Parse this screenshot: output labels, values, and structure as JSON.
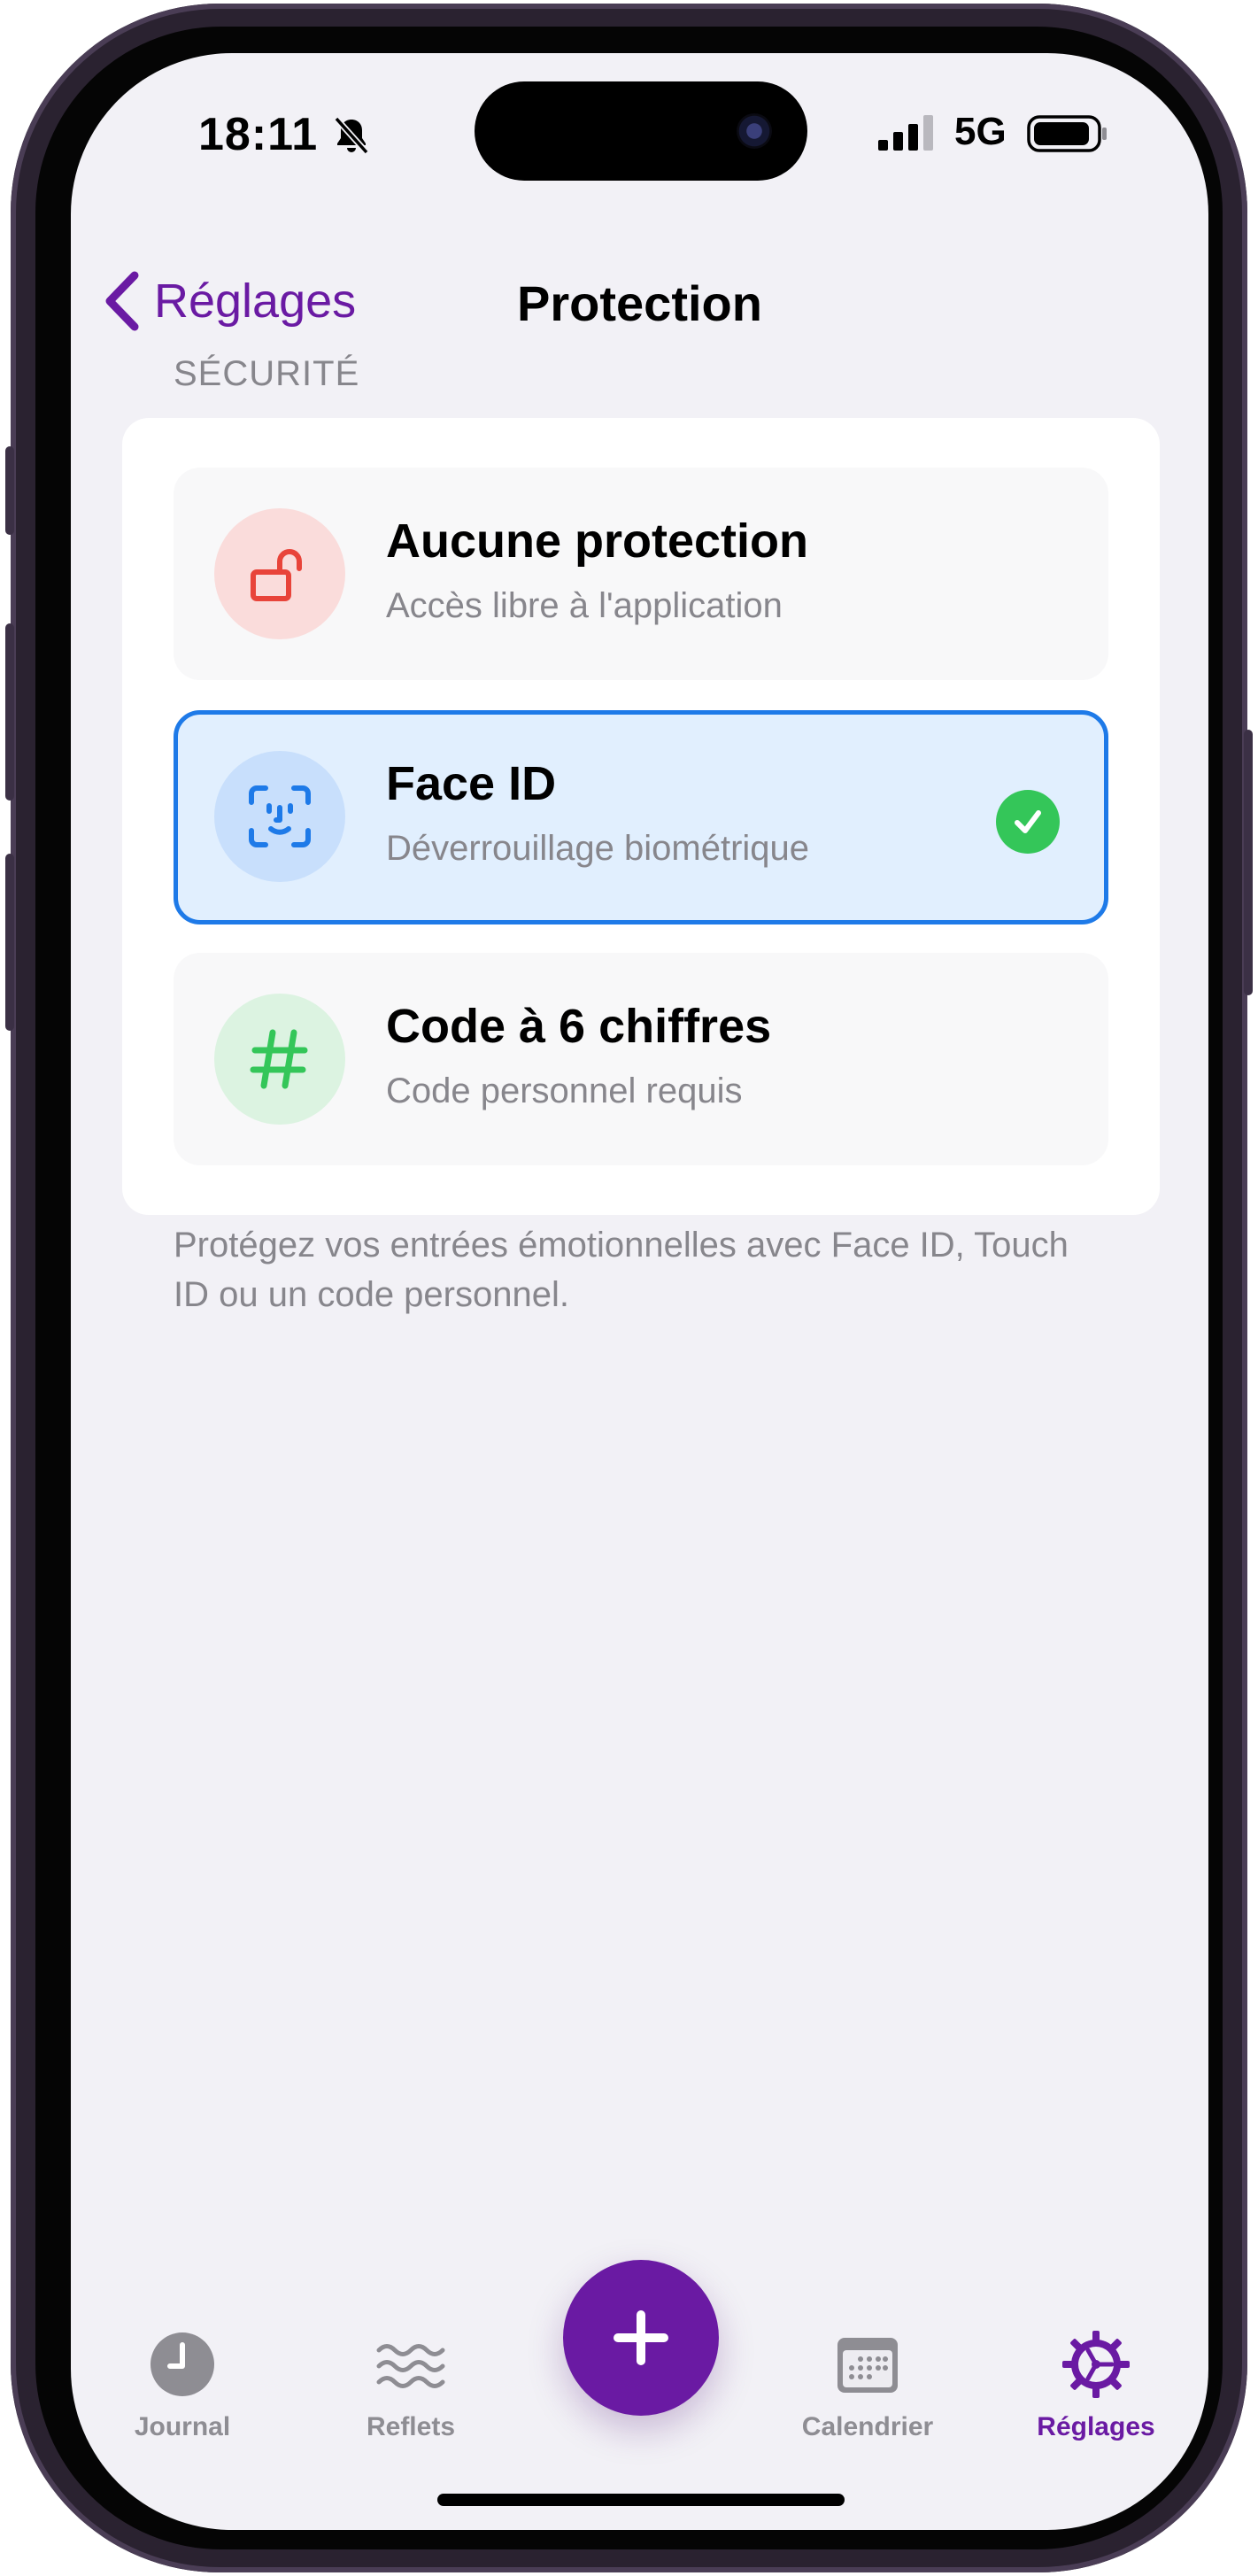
{
  "status_bar": {
    "time": "18:11",
    "network": "5G"
  },
  "nav": {
    "back_label": "Réglages",
    "title": "Protection"
  },
  "section": {
    "header": "SÉCURITÉ",
    "footer": "Protégez vos entrées émotionnelles avec Face ID, Touch ID ou un code personnel."
  },
  "options": [
    {
      "title": "Aucune protection",
      "subtitle": "Accès libre à l'application",
      "icon": "unlock-icon",
      "icon_color": "#e8443a",
      "icon_bg": "#fadcdb",
      "selected": false
    },
    {
      "title": "Face ID",
      "subtitle": "Déverrouillage biométrique",
      "icon": "face-id-icon",
      "icon_color": "#1e7ae8",
      "icon_bg": "#c8dffc",
      "selected": true
    },
    {
      "title": "Code à 6 chiffres",
      "subtitle": "Code personnel requis",
      "icon": "hash-icon",
      "icon_color": "#34c659",
      "icon_bg": "#dcf3e1",
      "selected": false
    }
  ],
  "tabs": [
    {
      "label": "Journal",
      "icon": "clock-icon",
      "active": false
    },
    {
      "label": "Reflets",
      "icon": "waves-icon",
      "active": false
    },
    {
      "label": "Calendrier",
      "icon": "calendar-icon",
      "active": false
    },
    {
      "label": "Réglages",
      "icon": "gear-icon",
      "active": true
    }
  ],
  "colors": {
    "accent": "#6a1aa3",
    "selected_border": "#1e7ae8",
    "check_green": "#34c659",
    "background": "#f2f1f6"
  }
}
